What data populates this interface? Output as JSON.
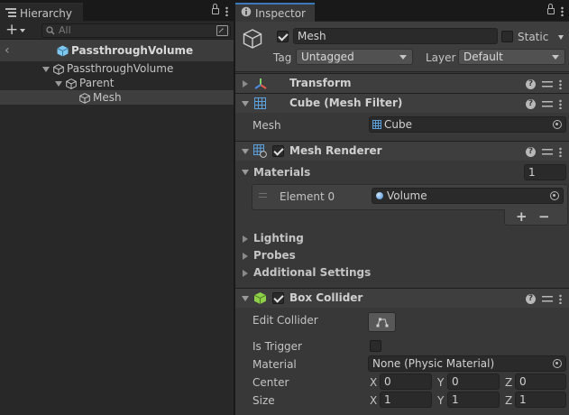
{
  "hierarchy": {
    "tab_label": "Hierarchy",
    "add_label": "+",
    "search_placeholder": "All",
    "scene_name": "PassthroughVolume",
    "items": [
      {
        "label": "PassthroughVolume"
      },
      {
        "label": "Parent"
      },
      {
        "label": "Mesh"
      }
    ]
  },
  "inspector": {
    "tab_label": "Inspector",
    "object_name": "Mesh",
    "static_label": "Static",
    "tag_label": "Tag",
    "tag_value": "Untagged",
    "layer_label": "Layer",
    "layer_value": "Default",
    "components": {
      "transform": {
        "title": "Transform"
      },
      "mesh_filter": {
        "title": "Cube (Mesh Filter)",
        "mesh_label": "Mesh",
        "mesh_value": "Cube"
      },
      "mesh_renderer": {
        "title": "Mesh Renderer",
        "materials_label": "Materials",
        "materials_count": "1",
        "element_label": "Element 0",
        "element_value": "Volume",
        "add_label": "+",
        "remove_label": "−",
        "lighting_label": "Lighting",
        "probes_label": "Probes",
        "additional_label": "Additional Settings"
      },
      "box_collider": {
        "title": "Box Collider",
        "edit_label": "Edit Collider",
        "trigger_label": "Is Trigger",
        "material_label": "Material",
        "material_value": "None (Physic Material)",
        "center_label": "Center",
        "size_label": "Size",
        "center": {
          "x": "0",
          "y": "0",
          "z": "0"
        },
        "size": {
          "x": "1",
          "y": "1",
          "z": "1"
        },
        "axis_x": "X",
        "axis_y": "Y",
        "axis_z": "Z"
      }
    }
  },
  "colors": {
    "accent": "#3a79bb",
    "selection": "#3e3e3e",
    "cube_icon": "#7ec8f0"
  }
}
